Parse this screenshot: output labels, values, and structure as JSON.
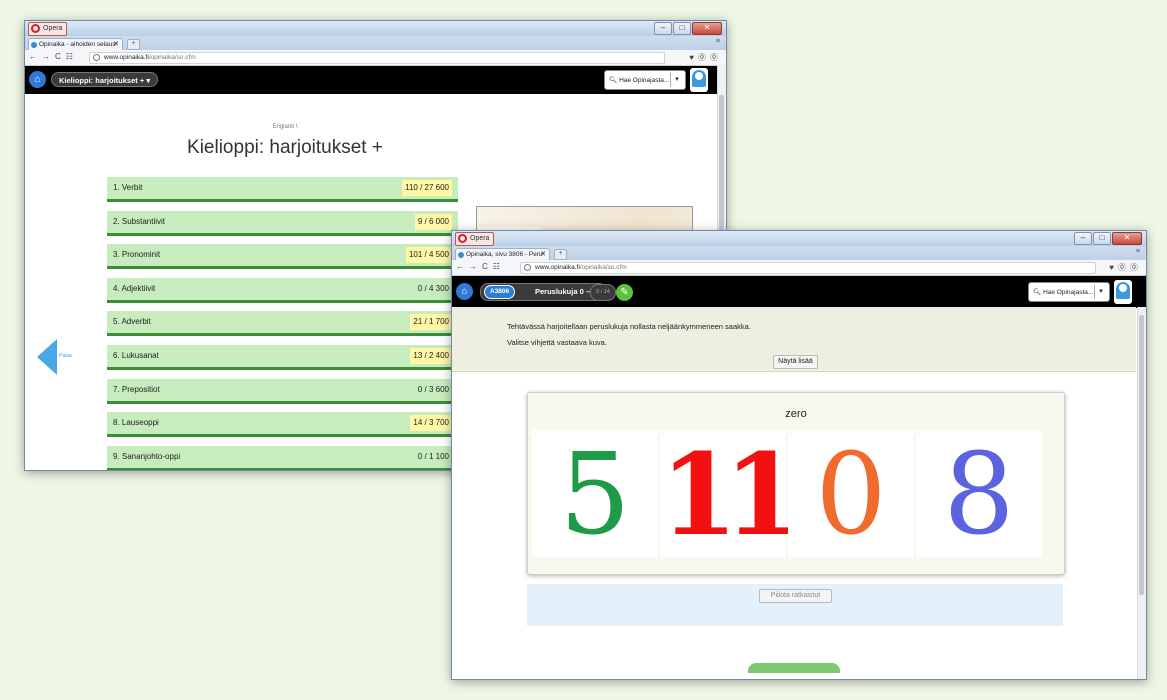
{
  "win1": {
    "browser": {
      "opera_label": "Opera",
      "tab_title": "Opinaika - aihoiden selaus",
      "url_host": "www.opinaika.fi",
      "url_path": "/opinaika/so.cfm"
    },
    "site": {
      "breadcrumb_pill": "Kielioppi: harjoitukset +",
      "search_placeholder": "Hae Opinajasta..."
    },
    "breadcrumb": "Englanti \\",
    "title": "Kielioppi: harjoitukset +",
    "back_label": "Palaa",
    "topics": [
      {
        "label": "1. Verbit",
        "count": "110 / 27 600",
        "highlight": true
      },
      {
        "label": "2. Substantiivit",
        "count": "9 / 6 000",
        "highlight": true
      },
      {
        "label": "3. Pronominit",
        "count": "101 / 4 500",
        "highlight": true
      },
      {
        "label": "4. Adjektiivit",
        "count": "0 / 4 300",
        "highlight": false
      },
      {
        "label": "5. Adverbit",
        "count": "21 / 1 700",
        "highlight": true
      },
      {
        "label": "6. Lukusanat",
        "count": "13 / 2 400",
        "highlight": true
      },
      {
        "label": "7. Prepositiot",
        "count": "0 / 3 600",
        "highlight": false
      },
      {
        "label": "8. Lauseoppi",
        "count": "14 / 3 700",
        "highlight": true
      },
      {
        "label": "9. Sananjohto-oppi",
        "count": "0 / 1 100",
        "highlight": false
      }
    ]
  },
  "win2": {
    "browser": {
      "opera_label": "Opera",
      "tab_title": "Opinaika, sivu 3806 - Peru",
      "url_host": "www.opinaika.fi",
      "url_path": "/opinaika/so.cfm"
    },
    "site": {
      "exercise_code": "A3806",
      "exercise_title": "Peruslukuja 0 – 40",
      "progress": "0 / 14",
      "search_placeholder": "Hae Opinajasta..."
    },
    "intro_line1": "Tehtävässä harjoitellaan peruslukuja nollasta neljäänkymmeneen saakka.",
    "intro_line2": "Valitse vihjettä vastaava kuva.",
    "show_more": "Näytä lisää",
    "prompt_word": "zero",
    "choices": [
      {
        "value": "5",
        "color": "#1e9b46"
      },
      {
        "value": "11",
        "color": "#f21010"
      },
      {
        "value": "0",
        "color": "#f26b2e"
      },
      {
        "value": "8",
        "color": "#5b63e0"
      }
    ],
    "hide_solved": "Piilota ratkaistut"
  }
}
